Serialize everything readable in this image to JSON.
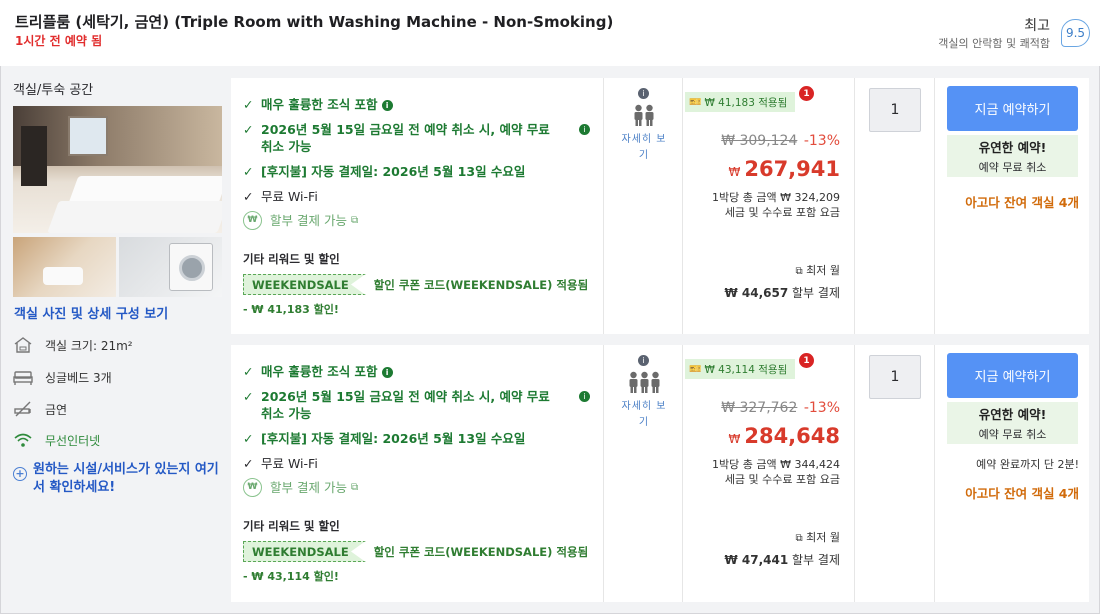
{
  "header": {
    "title": "트리플룸 (세탁기, 금연) (Triple Room with Washing Machine - Non-Smoking)",
    "booked_recent": "1시간 전 예약 됨",
    "rating_word": "최고",
    "rating_sub": "객실의 안락함 및 쾌적함",
    "rating_score": "9.5"
  },
  "left": {
    "heading": "객실/투숙 공간",
    "photo_link": "객실 사진 및 상세 구성 보기",
    "features": [
      {
        "icon": "room-size-icon",
        "label": "객실 크기: 21m²"
      },
      {
        "icon": "bed-icon",
        "label": "싱글베드 3개"
      },
      {
        "icon": "no-smoking-icon",
        "label": "금연"
      },
      {
        "icon": "wifi-icon",
        "label": "무선인터넷"
      }
    ],
    "help_plus": "+",
    "help_link": "원하는 시설/서비스가 있는지 여기서 확인하세요!"
  },
  "offers": [
    {
      "benefits": [
        "매우 훌륭한 조식 포함",
        "2026년 5월 15일 금요일 전 예약 취소 시, 예약 무료 취소 가능",
        "[후지불] 자동 결제일: 2026년 5월 13일 수요일",
        "무료 Wi-Fi",
        "할부 결제 가능"
      ],
      "rewards_title": "기타 리워드 및 할인",
      "coupon_code": "WEEKENDSALE",
      "coupon_text": "할인 쿠폰 코드(WEEKENDSALE) 적용됨",
      "coupon_discount": "- ₩ 41,183 할인!",
      "occupancy_label": "자세히 보기",
      "occupancy_count": 2,
      "promo_text": "₩ 41,183 적용됨",
      "promo_badge": "1",
      "original_price": "₩ 309,124",
      "discount_pct": "-13%",
      "currency": "₩",
      "price": "267,941",
      "per_night_1": "1박당 총 금액 ₩ 324,209",
      "per_night_2": "세금 및 수수료 포함 요금",
      "lowest_label": "최저 월",
      "installment_amount": "₩ 44,657",
      "installment_label": "할부 결제",
      "quantity": "1",
      "book_label": "지금 예약하기",
      "flex_title": "유연한 예약!",
      "flex_sub": "예약 무료 취소",
      "last_booking": "",
      "rooms_left": "아고다 잔여 객실 4개"
    },
    {
      "benefits": [
        "매우 훌륭한 조식 포함",
        "2026년 5월 15일 금요일 전 예약 취소 시, 예약 무료 취소 가능",
        "[후지불] 자동 결제일: 2026년 5월 13일 수요일",
        "무료 Wi-Fi",
        "할부 결제 가능"
      ],
      "rewards_title": "기타 리워드 및 할인",
      "coupon_code": "WEEKENDSALE",
      "coupon_text": "할인 쿠폰 코드(WEEKENDSALE) 적용됨",
      "coupon_discount": "- ₩ 43,114 할인!",
      "occupancy_label": "자세히 보기",
      "occupancy_count": 3,
      "promo_text": "₩ 43,114 적용됨",
      "promo_badge": "1",
      "original_price": "₩ 327,762",
      "discount_pct": "-13%",
      "currency": "₩",
      "price": "284,648",
      "per_night_1": "1박당 총 금액 ₩ 344,424",
      "per_night_2": "세금 및 수수료 포함 요금",
      "lowest_label": "최저 월",
      "installment_amount": "₩ 47,441",
      "installment_label": "할부 결제",
      "quantity": "1",
      "book_label": "지금 예약하기",
      "flex_title": "유연한 예약!",
      "flex_sub": "예약 무료 취소",
      "last_booking": "예약 완료까지 단 2분!",
      "rooms_left": "아고다 잔여 객실 4개"
    }
  ],
  "colors": {
    "benefit_green": "#1d7a32",
    "price_red": "#d83a2b",
    "book_blue": "#5592f5",
    "scarcity_orange": "#d16b0b",
    "link_blue": "#2459c5"
  }
}
